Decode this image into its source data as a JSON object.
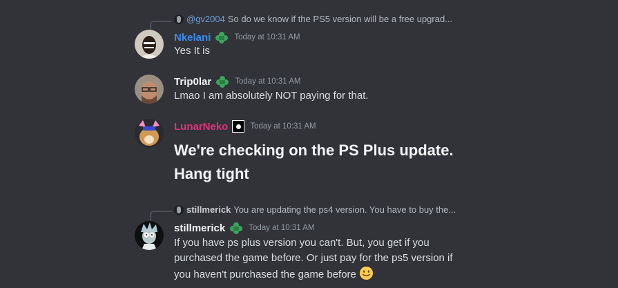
{
  "messages": [
    {
      "reply_to": {
        "name": "@gv2004",
        "text": "So do we know if the PS5 version will be a free upgrad..."
      },
      "author": "Nkelani",
      "author_color": "#3b8cf0",
      "timestamp": "Today at 10:31 AM",
      "badge": "leaf-badge-icon",
      "text": "Yes It is"
    },
    {
      "author": "Trip0lar",
      "author_color": "#f2f3f5",
      "timestamp": "Today at 10:31 AM",
      "badge": "leaf-badge-icon",
      "text": "Lmao I am absolutely NOT paying for that."
    },
    {
      "author": "LunarNeko",
      "author_color": "#e0307a",
      "timestamp": "Today at 10:31 AM",
      "badge": "role-square-icon",
      "text_line1": "We're checking on the PS Plus update.",
      "text_line2": "Hang tight"
    },
    {
      "reply_to": {
        "name": "stillmerick",
        "text": "You are updating the ps4 version. You have to buy the..."
      },
      "author": "stillmerick",
      "author_color": "#f2f3f5",
      "timestamp": "Today at 10:31 AM",
      "badge": "leaf-badge-icon",
      "text_line1": "If you have ps plus version you can't. But, you get if you",
      "text_line2": "purchased the game before. Or just pay for the ps5 version if",
      "text_line3": "you haven't purchased the game before",
      "emoji": "slightly-smiling-face-emoji"
    }
  ],
  "colors": {
    "background": "#313338",
    "badge_green": "#3ba55c"
  }
}
